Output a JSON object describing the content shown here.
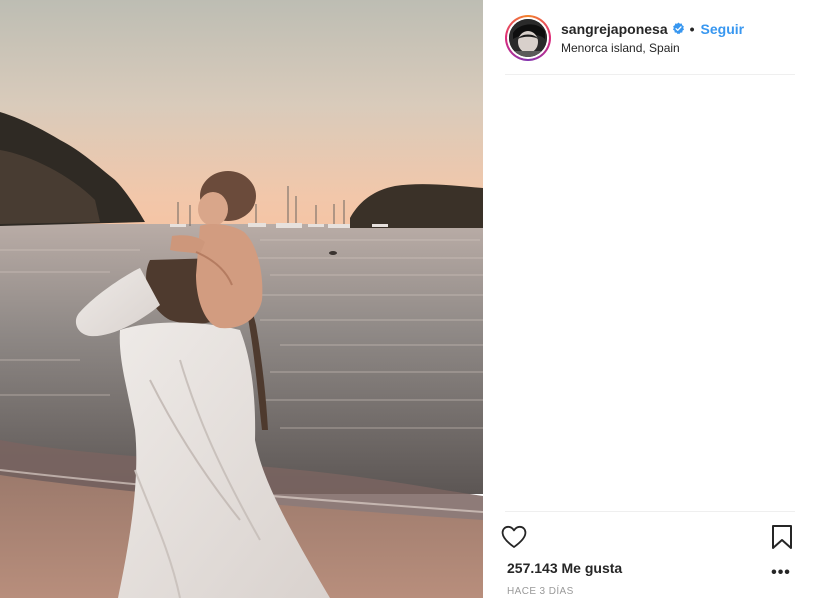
{
  "post": {
    "username": "sangrejaponesa",
    "verified": true,
    "separator": "•",
    "follow_label": "Seguir",
    "location": "Menorca island, Spain",
    "likes_text": "257.143 Me gusta",
    "timestamp": "HACE 3 DÍAS",
    "more_label": "•••"
  },
  "icons": {
    "verified": "verified-badge-icon",
    "like": "heart-icon",
    "save": "bookmark-icon",
    "more": "more-options-icon"
  },
  "colors": {
    "link_blue": "#3897f0",
    "text_dark": "#262626",
    "text_muted": "#999999",
    "divider": "#efefef",
    "sky_top": "#c9c7bd",
    "sky_horizon": "#f2c4a6",
    "sea": "#8b8683",
    "sand": "#a98271"
  }
}
